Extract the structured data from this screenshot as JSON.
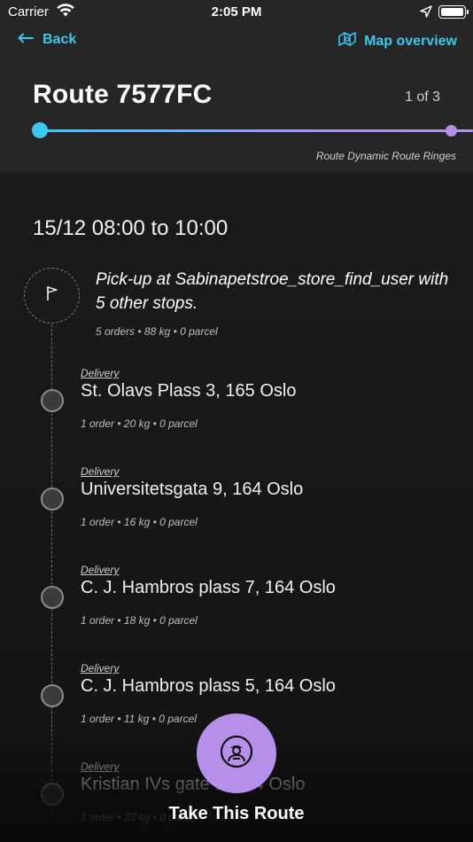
{
  "status_bar": {
    "carrier": "Carrier",
    "time": "2:05 PM"
  },
  "nav": {
    "back_label": "Back",
    "map_overview_label": "Map overview"
  },
  "route": {
    "title": "Route 7577FC",
    "counter": "1 of 3",
    "subtitle": "Route Dynamic Route Ringes"
  },
  "schedule": {
    "date_range": "15/12 08:00 to 10:00"
  },
  "pickup": {
    "title": "Pick-up at Sabinapetstroe_store_find_user with 5 other stops.",
    "meta": "5 orders • 88 kg • 0 parcel"
  },
  "stops": [
    {
      "type": "Delivery",
      "address": "St. Olavs Plass 3, 165 Oslo",
      "meta": "1 order • 20 kg • 0 parcel"
    },
    {
      "type": "Delivery",
      "address": "Universitetsgata 9, 164 Oslo",
      "meta": "1 order • 16 kg • 0 parcel"
    },
    {
      "type": "Delivery",
      "address": "C. J. Hambros plass 7, 164 Oslo",
      "meta": "1 order • 18 kg • 0 parcel"
    },
    {
      "type": "Delivery",
      "address": "C. J. Hambros plass 5, 164 Oslo",
      "meta": "1 order • 11 kg • 0 parcel"
    },
    {
      "type": "Delivery",
      "address": "Kristian IVs gate 1, 164 Oslo",
      "meta": "1 order • 23 kg • 0 parcel"
    }
  ],
  "action": {
    "take_route_label": "Take This Route",
    "icon": "driver-icon"
  },
  "colors": {
    "accent_cyan": "#3cc7ee",
    "accent_purple": "#b690ea",
    "header_bg": "#262626",
    "body_bg": "#141414"
  }
}
